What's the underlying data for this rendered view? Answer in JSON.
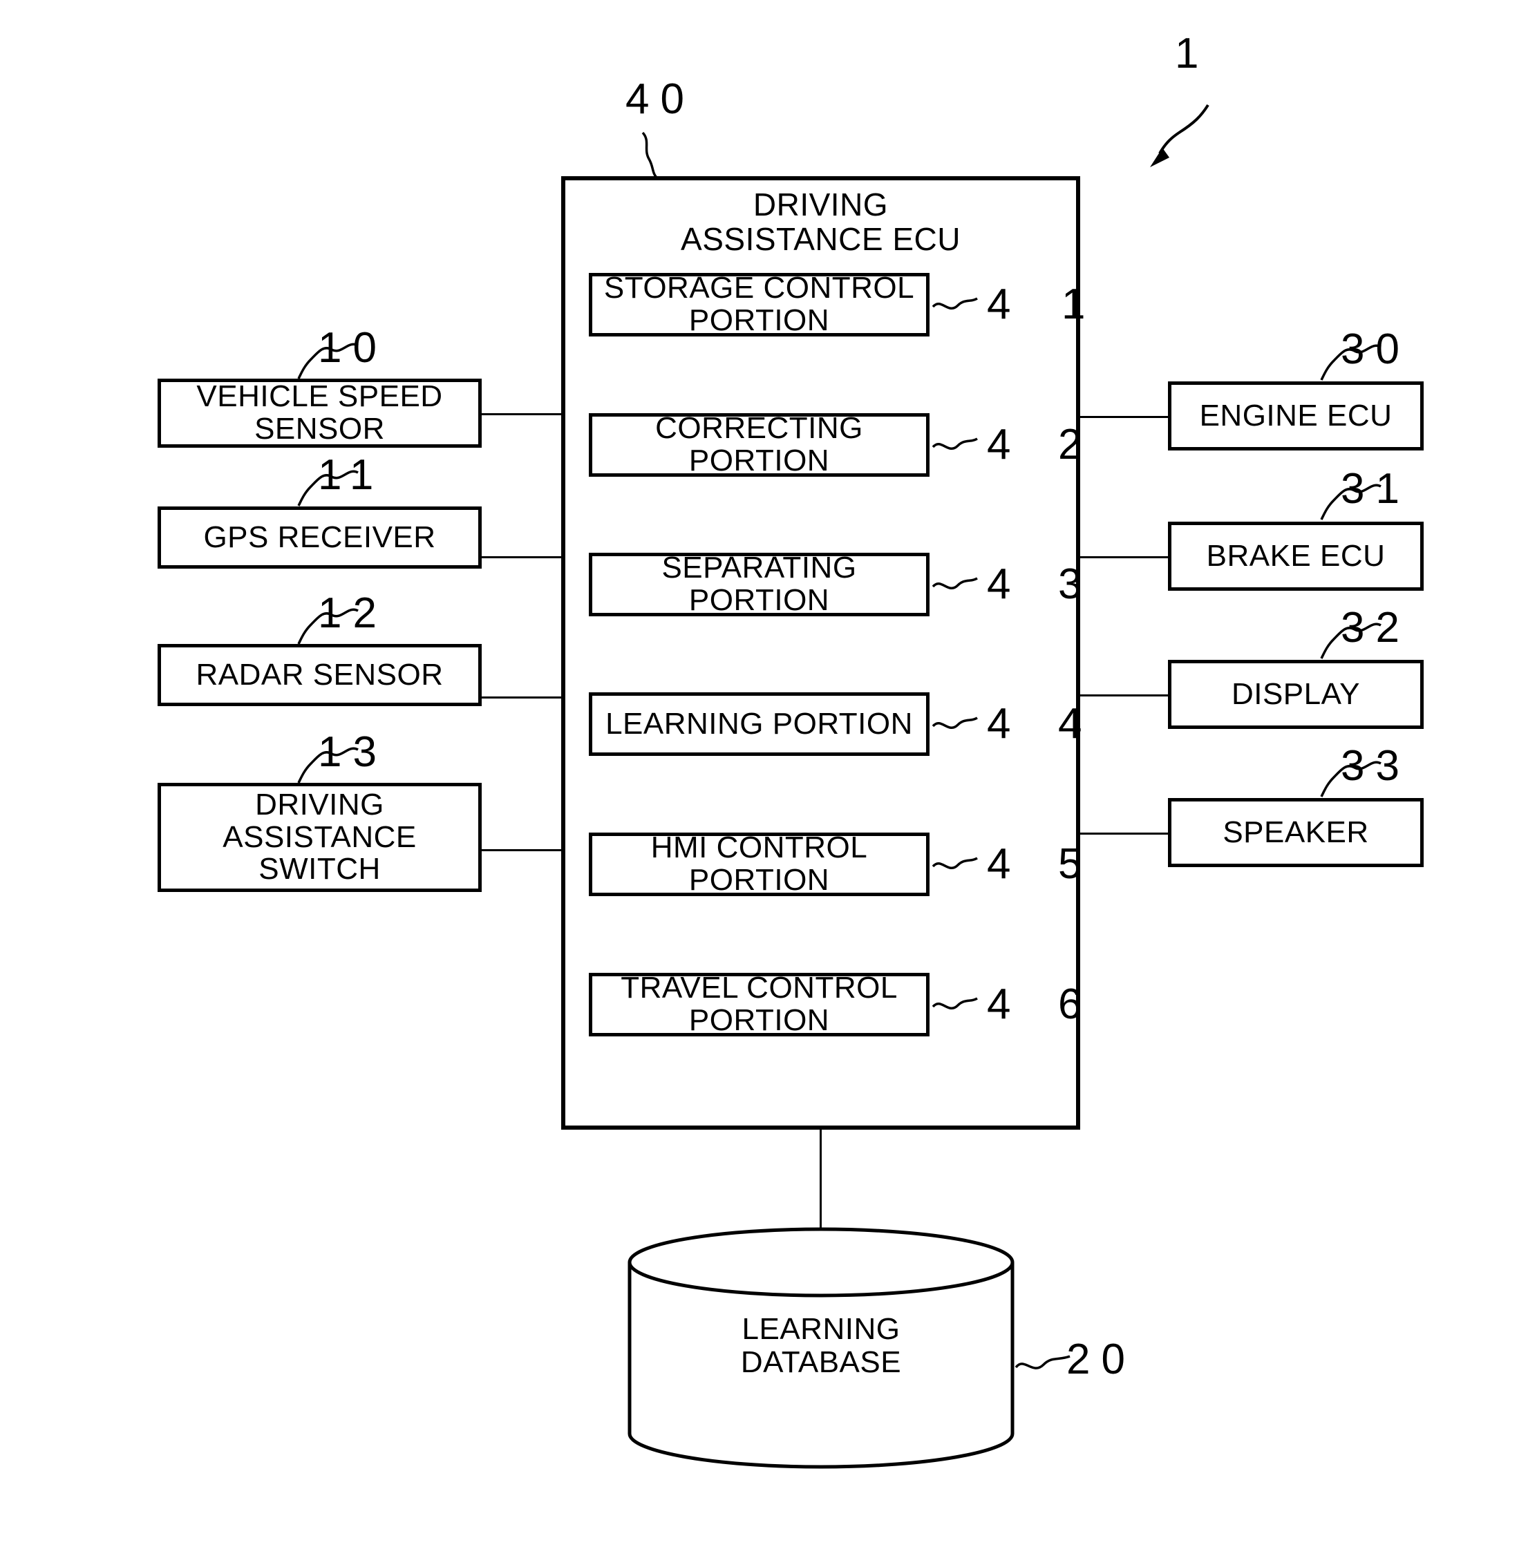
{
  "figure": {
    "system_ref": "1",
    "ecu": {
      "ref": "40",
      "title": "DRIVING\nASSISTANCE ECU",
      "portions": [
        {
          "ref": "41",
          "ref_first": "4",
          "ref_second": "1",
          "label": "STORAGE CONTROL\nPORTION"
        },
        {
          "ref": "42",
          "ref_first": "4",
          "ref_second": "2",
          "label": "CORRECTING\nPORTION"
        },
        {
          "ref": "43",
          "ref_first": "4",
          "ref_second": "3",
          "label": "SEPARATING\nPORTION"
        },
        {
          "ref": "44",
          "ref_first": "4",
          "ref_second": "4",
          "label": "LEARNING PORTION"
        },
        {
          "ref": "45",
          "ref_first": "4",
          "ref_second": "5",
          "label": "HMI CONTROL\nPORTION"
        },
        {
          "ref": "46",
          "ref_first": "4",
          "ref_second": "6",
          "label": "TRAVEL CONTROL\nPORTION"
        }
      ]
    },
    "inputs": [
      {
        "ref": "10",
        "label": "VEHICLE SPEED\nSENSOR"
      },
      {
        "ref": "11",
        "label": "GPS RECEIVER"
      },
      {
        "ref": "12",
        "label": "RADAR SENSOR"
      },
      {
        "ref": "13",
        "label": "DRIVING\nASSISTANCE\nSWITCH"
      }
    ],
    "outputs": [
      {
        "ref": "30",
        "label": "ENGINE ECU"
      },
      {
        "ref": "31",
        "label": "BRAKE ECU"
      },
      {
        "ref": "32",
        "label": "DISPLAY"
      },
      {
        "ref": "33",
        "label": "SPEAKER"
      }
    ],
    "database": {
      "ref": "20",
      "label": "LEARNING\nDATABASE"
    }
  }
}
